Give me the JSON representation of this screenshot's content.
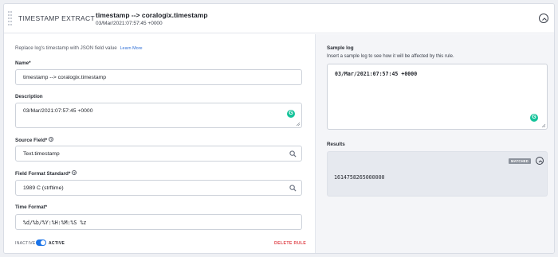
{
  "header": {
    "rule_type": "TIMESTAMP EXTRACT",
    "rule_name": "timestamp --> coralogix.timestamp",
    "rule_subtitle": "03/Mar/2021:07:57:45 +0000"
  },
  "form": {
    "intro_text": "Replace log's timestamp with JSON field value",
    "learn_more": "Learn More",
    "name_label": "Name*",
    "name_value": "timestamp --> coralogix.timestamp",
    "description_label": "Description",
    "description_value": "03/Mar/2021:07:57:45 +0000",
    "source_field_label": "Source Field*",
    "source_field_value": "Text.timestamp",
    "format_standard_label": "Field Format Standard*",
    "format_standard_value": "1989 C (strftime)",
    "time_format_label": "Time Format*",
    "time_format_value": "%d/%b/%Y:%H:%M:%S %z",
    "help_glyph": "?",
    "toggle_inactive": "INACTIVE",
    "toggle_active": "ACTIVE",
    "toggle_on": true,
    "delete_rule": "DELETE RULE"
  },
  "sample": {
    "label": "Sample log",
    "hint": "Insert a sample log to see how it will be affected by this rule.",
    "value": "03/Mar/2021:07:57:45 +0000"
  },
  "results": {
    "label": "Results",
    "badge": "MATCHED",
    "value": "1614758265000000"
  },
  "icons": {
    "grammarly_letter": "G"
  },
  "colors": {
    "accent": "#1a73e8",
    "danger": "#e0474d",
    "grammarly": "#15c39a"
  }
}
